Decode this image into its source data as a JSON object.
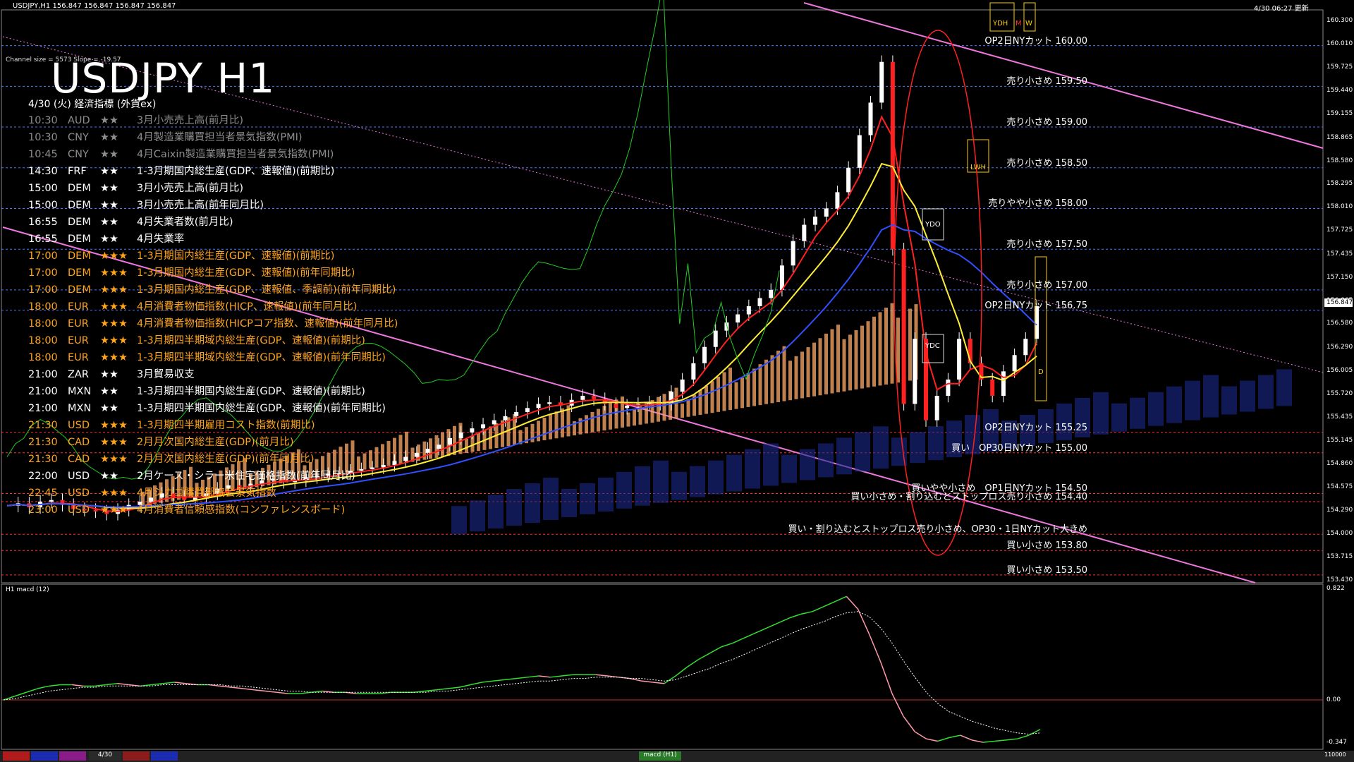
{
  "header": {
    "symbol_info": "USDJPY,H1  156.847 156.847 156.847 156.847",
    "datetime": "4/30 06:27 更新"
  },
  "title": "USDJPY H1",
  "channel_info": "Channel size = 5573 Slope = -19.57",
  "calendar_title": "4/30 (火) 経済指標 (外貨ex)",
  "events": [
    {
      "time": "10:30",
      "cur": "AUD",
      "stars": "★★",
      "name": "3月小売売上高(前月比)",
      "color": "#8c8c8c"
    },
    {
      "time": "10:30",
      "cur": "CNY",
      "stars": "★★",
      "name": "4月製造業購買担当者景気指数(PMI)",
      "color": "#8c8c8c"
    },
    {
      "time": "10:45",
      "cur": "CNY",
      "stars": "★★",
      "name": "4月Caixin製造業購買担当者景気指数(PMI)",
      "color": "#8c8c8c"
    },
    {
      "time": "14:30",
      "cur": "FRF",
      "stars": "★★",
      "name": "1-3月期国内総生産(GDP、速報値)(前期比)",
      "color": "#ffffff"
    },
    {
      "time": "15:00",
      "cur": "DEM",
      "stars": "★★",
      "name": "3月小売売上高(前月比)",
      "color": "#ffffff"
    },
    {
      "time": "15:00",
      "cur": "DEM",
      "stars": "★★",
      "name": "3月小売売上高(前年同月比)",
      "color": "#ffffff"
    },
    {
      "time": "16:55",
      "cur": "DEM",
      "stars": "★★",
      "name": "4月失業者数(前月比)",
      "color": "#ffffff"
    },
    {
      "time": "16:55",
      "cur": "DEM",
      "stars": "★★",
      "name": "4月失業率",
      "color": "#ffffff"
    },
    {
      "time": "17:00",
      "cur": "DEM",
      "stars": "★★★",
      "name": "1-3月期国内総生産(GDP、速報値)(前期比)",
      "color": "#ffa31a"
    },
    {
      "time": "17:00",
      "cur": "DEM",
      "stars": "★★★",
      "name": "1-3月期国内総生産(GDP、速報値)(前年同期比)",
      "color": "#ffa31a"
    },
    {
      "time": "17:00",
      "cur": "DEM",
      "stars": "★★★",
      "name": "1-3月期国内総生産(GDP、速報値、季調前)(前年同期比)",
      "color": "#ffa31a"
    },
    {
      "time": "18:00",
      "cur": "EUR",
      "stars": "★★★",
      "name": "4月消費者物価指数(HICP、速報値)(前年同月比)",
      "color": "#ffa31a"
    },
    {
      "time": "18:00",
      "cur": "EUR",
      "stars": "★★★",
      "name": "4月消費者物価指数(HICPコア指数、速報値)(前年同月比)",
      "color": "#ffa31a"
    },
    {
      "time": "18:00",
      "cur": "EUR",
      "stars": "★★★",
      "name": "1-3月期四半期域内総生産(GDP、速報値)(前期比)",
      "color": "#ffa31a"
    },
    {
      "time": "18:00",
      "cur": "EUR",
      "stars": "★★★",
      "name": "1-3月期四半期域内総生産(GDP、速報値)(前年同期比)",
      "color": "#ffa31a"
    },
    {
      "time": "21:00",
      "cur": "ZAR",
      "stars": "★★",
      "name": "3月貿易収支",
      "color": "#ffffff"
    },
    {
      "time": "21:00",
      "cur": "MXN",
      "stars": "★★",
      "name": "1-3月期四半期国内総生産(GDP、速報値)(前期比)",
      "color": "#ffffff"
    },
    {
      "time": "21:00",
      "cur": "MXN",
      "stars": "★★",
      "name": "1-3月期四半期国内総生産(GDP、速報値)(前年同期比)",
      "color": "#ffffff"
    },
    {
      "time": "21:30",
      "cur": "USD",
      "stars": "★★★",
      "name": "1-3月期四半期雇用コスト指数(前期比)",
      "color": "#ffa31a"
    },
    {
      "time": "21:30",
      "cur": "CAD",
      "stars": "★★★",
      "name": "2月月次国内総生産(GDP)(前月比)",
      "color": "#ffa31a"
    },
    {
      "time": "21:30",
      "cur": "CAD",
      "stars": "★★★",
      "name": "2月月次国内総生産(GDP)(前年同月比)",
      "color": "#ffa31a"
    },
    {
      "time": "22:00",
      "cur": "USD",
      "stars": "★★",
      "name": "2月ケース・シラー米住宅価格指数(前年同月比)",
      "color": "#ffffff"
    },
    {
      "time": "22:45",
      "cur": "USD",
      "stars": "★★★",
      "name": "4月シカゴ購買部協会景気指数",
      "color": "#ffa31a"
    },
    {
      "time": "23:00",
      "cur": "USD",
      "stars": "★★★",
      "name": "4月消費者信頼感指数(コンファレンスボード)",
      "color": "#ffa31a"
    }
  ],
  "price_levels": [
    {
      "label": "OP2日NYカット 160.00",
      "price": 160.0,
      "color": "#4a78ff"
    },
    {
      "label": "売り小さめ 159.50",
      "price": 159.5,
      "color": "#4a78ff"
    },
    {
      "label": "売り小さめ 159.00",
      "price": 159.0,
      "color": "#4a78ff"
    },
    {
      "label": "売り小さめ 158.50",
      "price": 158.5,
      "color": "#4a78ff"
    },
    {
      "label": "売りやや小さめ 158.00",
      "price": 158.0,
      "color": "#4a78ff"
    },
    {
      "label": "売り小さめ 157.50",
      "price": 157.5,
      "color": "#4a78ff"
    },
    {
      "label": "売り小さめ 157.00",
      "price": 157.0,
      "color": "#4a78ff"
    },
    {
      "label": "OP2日NYカット 156.75",
      "price": 156.75,
      "color": "#4a78ff"
    },
    {
      "label": "OP2日NYカット 155.25",
      "price": 155.25,
      "color": "#ff3030"
    },
    {
      "label": "買い　OP30日NYカット 155.00",
      "price": 155.0,
      "color": "#ff3030"
    },
    {
      "label": "買いやや小さめ　OP1日NYカット 154.50",
      "price": 154.5,
      "color": "#ff3030"
    },
    {
      "label": "買い小さめ・割り込むとストップロス売り小さめ 154.40",
      "price": 154.4,
      "color": "#ff3030"
    },
    {
      "label": "買い・割り込むとストップロス売り小さめ、OP30・1日NYカット大きめ",
      "price": 154.0,
      "color": "#ff3030"
    },
    {
      "label": "買い小さめ 153.80",
      "price": 153.8,
      "color": "#ff3030"
    },
    {
      "label": "買い小さめ 153.50",
      "price": 153.5,
      "color": "#ff3030"
    }
  ],
  "box_labels": {
    "ydh": "YDH",
    "m": "M",
    "w": "W",
    "lwh": "LWH",
    "ydo": "YDO",
    "ydc": "YDC",
    "d": "D"
  },
  "price_axis": [
    "160.300",
    "160.010",
    "159.725",
    "159.440",
    "159.155",
    "158.865",
    "158.580",
    "158.295",
    "158.010",
    "157.725",
    "157.435",
    "157.150",
    "156.865",
    "156.580",
    "156.290",
    "156.005",
    "155.720",
    "155.435",
    "155.145",
    "154.860",
    "154.575",
    "154.290",
    "154.000",
    "153.715",
    "153.430"
  ],
  "current_price": "156.847",
  "macd": {
    "label": "H1  macd (12)",
    "axis": [
      "0.822",
      "0.00",
      "-0.347"
    ],
    "main": [
      0.0,
      0.03,
      0.06,
      0.09,
      0.11,
      0.12,
      0.12,
      0.11,
      0.11,
      0.12,
      0.13,
      0.12,
      0.11,
      0.12,
      0.13,
      0.14,
      0.13,
      0.12,
      0.12,
      0.11,
      0.1,
      0.09,
      0.08,
      0.07,
      0.06,
      0.05,
      0.05,
      0.06,
      0.07,
      0.06,
      0.06,
      0.05,
      0.05,
      0.05,
      0.06,
      0.06,
      0.06,
      0.07,
      0.08,
      0.09,
      0.1,
      0.12,
      0.14,
      0.15,
      0.16,
      0.17,
      0.18,
      0.19,
      0.18,
      0.19,
      0.2,
      0.2,
      0.2,
      0.19,
      0.18,
      0.17,
      0.15,
      0.14,
      0.13,
      0.19,
      0.26,
      0.32,
      0.37,
      0.42,
      0.45,
      0.49,
      0.53,
      0.57,
      0.61,
      0.65,
      0.68,
      0.7,
      0.74,
      0.78,
      0.82,
      0.72,
      0.52,
      0.3,
      0.05,
      -0.14,
      -0.27,
      -0.33,
      -0.35,
      -0.32,
      -0.3,
      -0.34,
      -0.36,
      -0.35,
      -0.34,
      -0.33,
      -0.3,
      -0.25
    ],
    "signal": [
      0.0,
      0.01,
      0.03,
      0.05,
      0.07,
      0.08,
      0.09,
      0.1,
      0.1,
      0.11,
      0.11,
      0.11,
      0.11,
      0.11,
      0.12,
      0.12,
      0.12,
      0.12,
      0.12,
      0.12,
      0.11,
      0.11,
      0.1,
      0.09,
      0.08,
      0.07,
      0.07,
      0.06,
      0.06,
      0.06,
      0.06,
      0.06,
      0.06,
      0.06,
      0.06,
      0.06,
      0.06,
      0.06,
      0.07,
      0.07,
      0.08,
      0.09,
      0.1,
      0.11,
      0.12,
      0.13,
      0.14,
      0.15,
      0.15,
      0.16,
      0.17,
      0.17,
      0.18,
      0.18,
      0.18,
      0.17,
      0.17,
      0.16,
      0.15,
      0.16,
      0.19,
      0.22,
      0.25,
      0.29,
      0.32,
      0.36,
      0.4,
      0.44,
      0.48,
      0.52,
      0.56,
      0.59,
      0.62,
      0.66,
      0.69,
      0.7,
      0.66,
      0.57,
      0.45,
      0.31,
      0.18,
      0.06,
      -0.03,
      -0.1,
      -0.14,
      -0.18,
      -0.21,
      -0.24,
      -0.26,
      -0.28,
      -0.29,
      -0.28
    ]
  },
  "footer": {
    "date_tab": "4/30",
    "macd_tab": "macd (H1)",
    "right_value": "110000"
  },
  "chart_data": {
    "type": "line",
    "title": "USDJPY H1",
    "ylim": [
      153.43,
      160.3
    ],
    "close": [
      154.35,
      154.38,
      154.33,
      154.4,
      154.42,
      154.36,
      154.31,
      154.3,
      154.28,
      154.25,
      154.3,
      154.36,
      154.4,
      154.45,
      154.5,
      154.46,
      154.42,
      154.45,
      154.5,
      154.56,
      154.6,
      154.58,
      154.62,
      154.66,
      154.68,
      154.64,
      154.66,
      154.7,
      154.72,
      154.74,
      154.75,
      154.78,
      154.8,
      154.82,
      154.85,
      154.9,
      154.95,
      155.0,
      155.05,
      155.1,
      155.18,
      155.25,
      155.3,
      155.35,
      155.4,
      155.45,
      155.5,
      155.55,
      155.6,
      155.62,
      155.58,
      155.65,
      155.7,
      155.66,
      155.6,
      155.55,
      155.58,
      155.6,
      155.62,
      155.6,
      155.75,
      155.9,
      156.1,
      156.3,
      156.5,
      156.6,
      156.7,
      156.8,
      156.9,
      157.0,
      157.3,
      157.6,
      157.8,
      157.9,
      158.0,
      158.2,
      158.5,
      158.9,
      159.3,
      159.8,
      157.5,
      155.6,
      156.4,
      155.4,
      155.7,
      155.9,
      156.4,
      156.1,
      155.9,
      155.7,
      156.0,
      156.2,
      156.4,
      156.8
    ]
  }
}
